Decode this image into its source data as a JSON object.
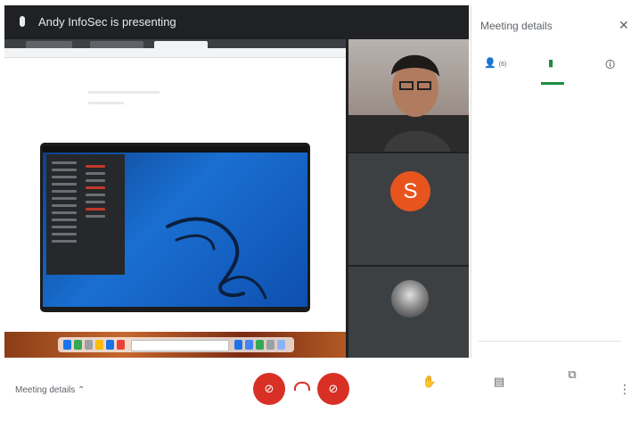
{
  "presenting_banner": "Andy InfoSec is presenting",
  "shared_browser": {
    "tabs": [
      "",
      "",
      ""
    ],
    "url": ""
  },
  "shared_dock": {
    "search_text": ""
  },
  "tiles": [
    {
      "name": "",
      "avatar_letter": ""
    },
    {
      "name": "",
      "avatar_letter": "S",
      "avatar_color": "#e8541e"
    },
    {
      "name": "",
      "avatar_letter": ""
    }
  ],
  "panel": {
    "title": "Meeting details",
    "close_icon": "close-icon",
    "tabs": [
      {
        "icon": "people-icon",
        "label": "(6)"
      },
      {
        "icon": "chat-icon",
        "label": ""
      },
      {
        "icon": "info-icon",
        "label": ""
      }
    ],
    "messages": [
      {
        "sender": "",
        "time": "",
        "text": "",
        "link": ""
      },
      {
        "sender": "",
        "time": "",
        "text": ""
      },
      {
        "sender": "",
        "time": "",
        "text": ""
      },
      {
        "sender": "",
        "time": "",
        "text": ""
      }
    ],
    "send_placeholder": ""
  },
  "bottom_bar": {
    "meeting_details": "Meeting details",
    "controls": [
      {
        "icon": "hand-icon",
        "label": ""
      },
      {
        "icon": "captions-icon",
        "label": ""
      },
      {
        "icon": "present-icon",
        "label": ""
      }
    ]
  },
  "colors": {
    "accent": "#1e8e3e",
    "danger": "#d93025",
    "dark": "#202124"
  }
}
